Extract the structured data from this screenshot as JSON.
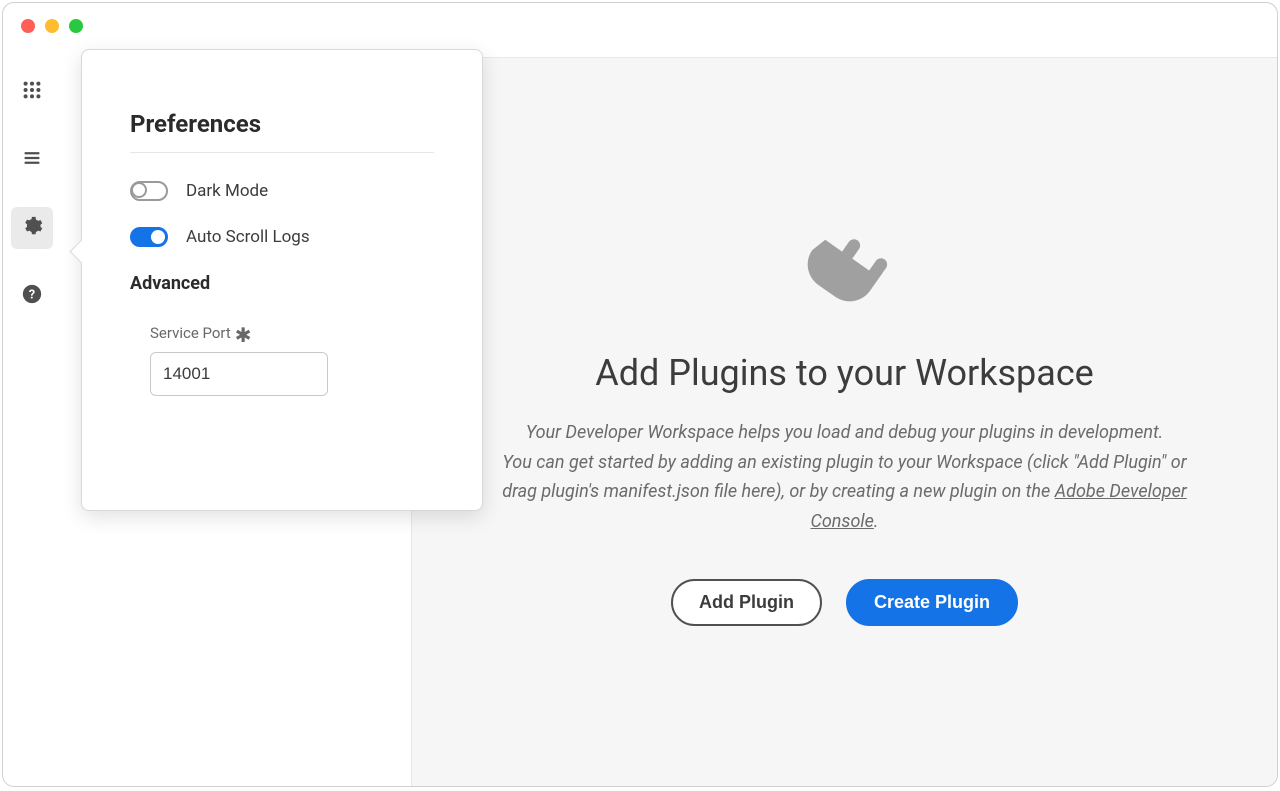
{
  "window": {},
  "sidebar": {
    "items": [
      {
        "name": "apps-icon"
      },
      {
        "name": "menu-icon"
      },
      {
        "name": "gear-icon"
      },
      {
        "name": "help-icon"
      }
    ],
    "active_index": 2
  },
  "main": {
    "heading": "Add Plugins to your Workspace",
    "desc_part1": "Your Developer Workspace helps you load and debug your plugins in development.",
    "desc_part2a": "You can get started by adding an existing plugin to your Workspace (click \"Add Plugin\" or drag plugin's manifest.json file here), or by creating a new plugin on the ",
    "desc_link": "Adobe Developer Console",
    "desc_part2b": ".",
    "add_button": "Add Plugin",
    "create_button": "Create Plugin"
  },
  "preferences": {
    "title": "Preferences",
    "dark_mode": {
      "label": "Dark Mode",
      "value": false
    },
    "auto_scroll": {
      "label": "Auto Scroll Logs",
      "value": true
    },
    "advanced_title": "Advanced",
    "service_port": {
      "label": "Service Port",
      "required": true,
      "value": "14001"
    }
  }
}
